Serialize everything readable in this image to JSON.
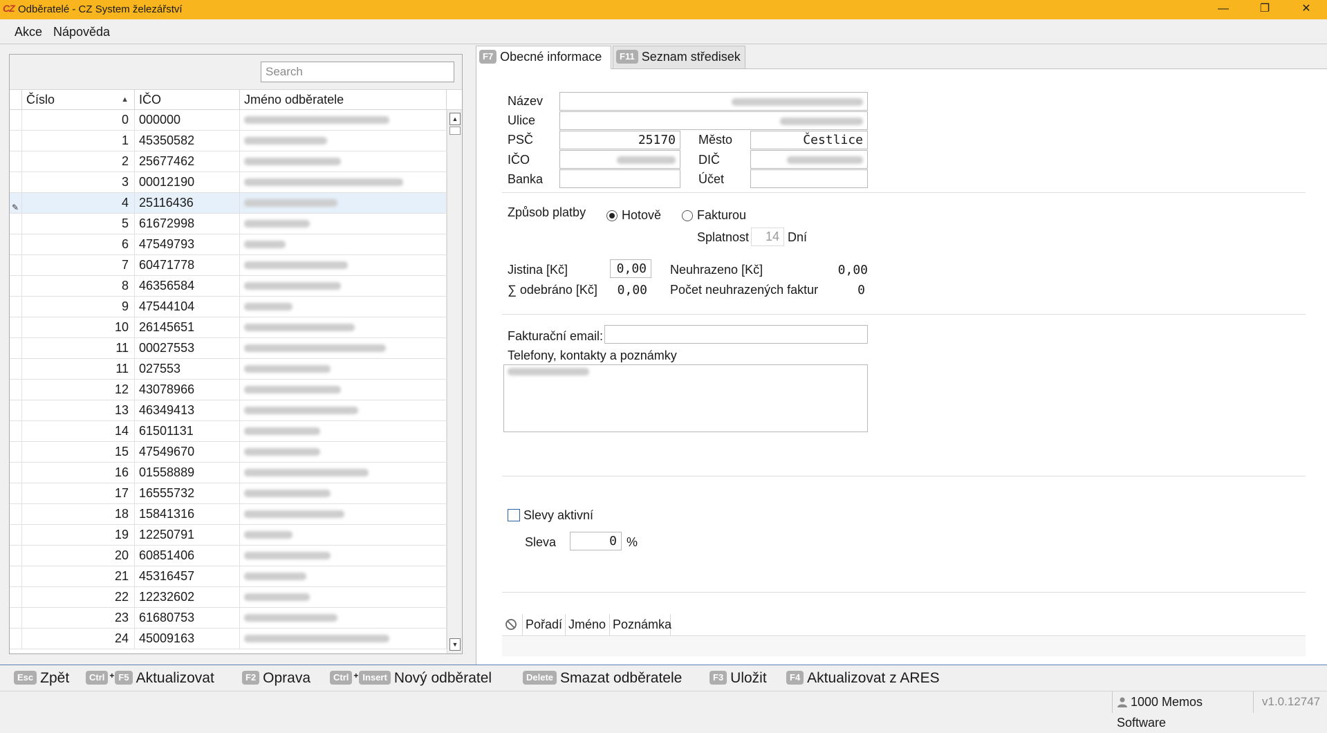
{
  "window": {
    "logo": "CZ",
    "title": "Odběratelé - CZ System železářství",
    "minimize": "—",
    "restore": "❐",
    "close": "✕"
  },
  "menu": {
    "items": [
      "Akce",
      "Nápověda"
    ]
  },
  "list": {
    "search_placeholder": "Search",
    "columns": [
      "Číslo",
      "IČO",
      "Jméno odběratele"
    ],
    "sort_indicator": "▲",
    "selected_index": 4,
    "rows": [
      {
        "num": "0",
        "ico": "000000"
      },
      {
        "num": "1",
        "ico": "45350582"
      },
      {
        "num": "2",
        "ico": "25677462"
      },
      {
        "num": "3",
        "ico": "00012190"
      },
      {
        "num": "4",
        "ico": "25116436"
      },
      {
        "num": "5",
        "ico": "61672998"
      },
      {
        "num": "6",
        "ico": "47549793"
      },
      {
        "num": "7",
        "ico": "60471778"
      },
      {
        "num": "8",
        "ico": "46356584"
      },
      {
        "num": "9",
        "ico": "47544104"
      },
      {
        "num": "10",
        "ico": "26145651"
      },
      {
        "num": "11",
        "ico": "00027553"
      },
      {
        "num": "11",
        "ico": "027553"
      },
      {
        "num": "12",
        "ico": "43078966"
      },
      {
        "num": "13",
        "ico": "46349413"
      },
      {
        "num": "14",
        "ico": "61501131"
      },
      {
        "num": "15",
        "ico": "47549670"
      },
      {
        "num": "16",
        "ico": "01558889"
      },
      {
        "num": "17",
        "ico": "16555732"
      },
      {
        "num": "18",
        "ico": "15841316"
      },
      {
        "num": "19",
        "ico": "12250791"
      },
      {
        "num": "20",
        "ico": "60851406"
      },
      {
        "num": "21",
        "ico": "45316457"
      },
      {
        "num": "22",
        "ico": "12232602"
      },
      {
        "num": "23",
        "ico": "61680753"
      },
      {
        "num": "24",
        "ico": "45009163"
      }
    ]
  },
  "tabs": [
    {
      "key": "F7",
      "label": "Obecné informace"
    },
    {
      "key": "F11",
      "label": "Seznam středisek"
    }
  ],
  "form": {
    "labels": {
      "nazev": "Název",
      "ulice": "Ulice",
      "psc": "PSČ",
      "mesto": "Město",
      "ico": "IČO",
      "dic": "DIČ",
      "banka": "Banka",
      "ucet": "Účet",
      "zpusob_platby": "Způsob platby",
      "hotove": "Hotově",
      "fakturou": "Fakturou",
      "splatnost": "Splatnost",
      "dni": "Dní",
      "jistina": "Jistina [Kč]",
      "neuhrazeno": "Neuhrazeno [Kč]",
      "odebrano": "∑ odebráno [Kč]",
      "pocet_neuhrazenych": "Počet neuhrazených faktur",
      "fakturacni_email": "Fakturační email:",
      "telefony": "Telefony, kontakty a poznámky",
      "slevy_aktivni": "Slevy aktivní",
      "sleva": "Sleva",
      "percent": "%"
    },
    "values": {
      "psc": "25170",
      "mesto": "Čestlice",
      "splatnost": "14",
      "jistina": "0,00",
      "neuhrazeno": "0,00",
      "odebrano": "0,00",
      "pocet_neuhrazenych": "0",
      "sleva": "0"
    },
    "payment_method": "Hotově",
    "slevy_aktivni_checked": false
  },
  "sub_grid": {
    "icon": "block-icon",
    "columns": [
      "Pořadí",
      "Jméno",
      "Poznámka"
    ]
  },
  "actions": [
    {
      "keys": [
        "Esc"
      ],
      "label": "Zpět"
    },
    {
      "keys": [
        "Ctrl",
        "F5"
      ],
      "label": "Aktualizovat"
    },
    {
      "keys": [
        "F2"
      ],
      "label": "Oprava"
    },
    {
      "keys": [
        "Ctrl",
        "Insert"
      ],
      "label": "Nový odběratel"
    },
    {
      "keys": [
        "Delete"
      ],
      "label": "Smazat odběratele"
    },
    {
      "keys": [
        "F3"
      ],
      "label": "Uložit"
    },
    {
      "keys": [
        "F4"
      ],
      "label": "Aktualizovat z ARES"
    }
  ],
  "status": {
    "user": "1000 Memos Software",
    "version": "v1.0.12747"
  }
}
